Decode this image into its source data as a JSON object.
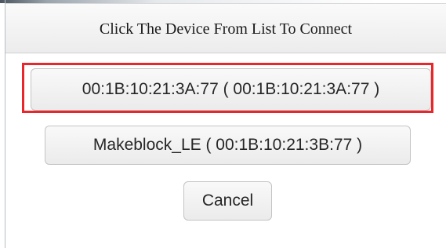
{
  "dialog": {
    "title": "Click The Device From List To Connect"
  },
  "devices": [
    {
      "label": "00:1B:10:21:3A:77 ( 00:1B:10:21:3A:77 )",
      "selected": true
    },
    {
      "label": "Makeblock_LE ( 00:1B:10:21:3B:77 )",
      "selected": false
    }
  ],
  "actions": {
    "cancel_label": "Cancel"
  },
  "colors": {
    "selection_outline": "#e8262b",
    "header_bg": "#ececec",
    "button_bg": "#f2f2f2"
  }
}
